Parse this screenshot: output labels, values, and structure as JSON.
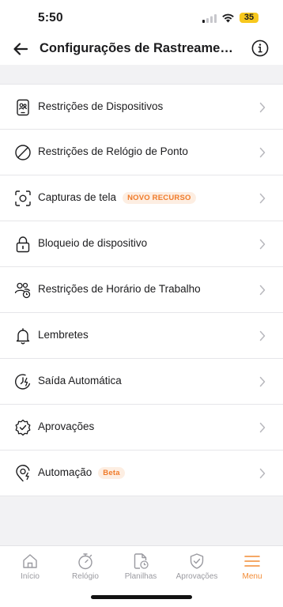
{
  "status_bar": {
    "time": "5:50",
    "battery": "35",
    "battery_color": "#f7c81e"
  },
  "header": {
    "title": "Configurações de Rastreamento"
  },
  "settings": {
    "items": [
      {
        "label": "Restrições de Dispositivos",
        "icon": "device-restrictions-icon"
      },
      {
        "label": "Restrições de Relógio de Ponto",
        "icon": "prohibited-icon"
      },
      {
        "label": "Capturas de tela",
        "icon": "screenshot-icon",
        "badge": "NOVO RECURSO"
      },
      {
        "label": "Bloqueio de dispositivo",
        "icon": "lock-icon"
      },
      {
        "label": "Restrições de Horário de Trabalho",
        "icon": "users-clock-icon"
      },
      {
        "label": "Lembretes",
        "icon": "bell-icon"
      },
      {
        "label": "Saída Automática",
        "icon": "auto-clock-out-icon"
      },
      {
        "label": "Aprovações",
        "icon": "approval-badge-icon"
      },
      {
        "label": "Automação",
        "icon": "automation-pin-icon",
        "badge": "Beta"
      }
    ]
  },
  "tab_bar": {
    "tabs": [
      {
        "label": "Início",
        "icon": "home-icon"
      },
      {
        "label": "Relógio",
        "icon": "stopwatch-icon"
      },
      {
        "label": "Planilhas",
        "icon": "timesheet-icon"
      },
      {
        "label": "Aprovações",
        "icon": "shield-check-icon"
      },
      {
        "label": "Menu",
        "icon": "menu-icon",
        "active": true
      }
    ]
  },
  "colors": {
    "accent": "#f28b34",
    "badge_bg": "#fdeee2",
    "badge_text": "#f07b2a",
    "background": "#f2f2f4"
  }
}
